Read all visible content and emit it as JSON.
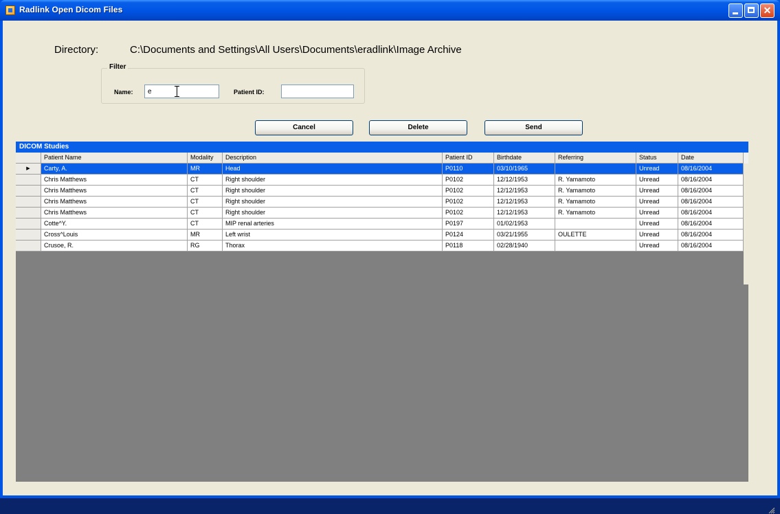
{
  "window": {
    "title": "Radlink Open Dicom Files",
    "icon": "radlink-app-icon",
    "controls": [
      "minimize-icon",
      "maximize-icon",
      "close-icon"
    ]
  },
  "directory": {
    "label": "Directory:",
    "path": "C:\\Documents and Settings\\All Users\\Documents\\eradlink\\Image Archive"
  },
  "filter": {
    "legend": "Filter",
    "name_label": "Name:",
    "name_value": "e",
    "patient_id_label": "Patient ID:",
    "patient_id_value": ""
  },
  "buttons": {
    "cancel": "Cancel",
    "delete": "Delete",
    "send": "Send"
  },
  "grid": {
    "caption": "DICOM Studies",
    "columns": [
      "Patient Name",
      "Modality",
      "Description",
      "Patient ID",
      "Birthdate",
      "Referring",
      "Status",
      "Date"
    ],
    "selected_row_indicator": "▶",
    "rows": [
      {
        "patient_name": "Carty, A.",
        "modality": "MR",
        "description": "Head",
        "patient_id": "P0110",
        "birthdate": "03/10/1965",
        "referring": "",
        "status": "Unread",
        "date": "08/16/2004",
        "selected": true
      },
      {
        "patient_name": "Chris Matthews",
        "modality": "CT",
        "description": "Right shoulder",
        "patient_id": "P0102",
        "birthdate": "12/12/1953",
        "referring": "R. Yamamoto",
        "status": "Unread",
        "date": "08/16/2004"
      },
      {
        "patient_name": "Chris Matthews",
        "modality": "CT",
        "description": "Right shoulder",
        "patient_id": "P0102",
        "birthdate": "12/12/1953",
        "referring": "R. Yamamoto",
        "status": "Unread",
        "date": "08/16/2004"
      },
      {
        "patient_name": "Chris Matthews",
        "modality": "CT",
        "description": "Right shoulder",
        "patient_id": "P0102",
        "birthdate": "12/12/1953",
        "referring": "R. Yamamoto",
        "status": "Unread",
        "date": "08/16/2004"
      },
      {
        "patient_name": "Chris Matthews",
        "modality": "CT",
        "description": "Right shoulder",
        "patient_id": "P0102",
        "birthdate": "12/12/1953",
        "referring": "R. Yamamoto",
        "status": "Unread",
        "date": "08/16/2004"
      },
      {
        "patient_name": "Cotte^Y.",
        "modality": "CT",
        "description": "MIP renal arteries",
        "patient_id": "P0197",
        "birthdate": "01/02/1953",
        "referring": "",
        "status": "Unread",
        "date": "08/16/2004"
      },
      {
        "patient_name": "Cross^Louis",
        "modality": "MR",
        "description": "Left wrist",
        "patient_id": "P0124",
        "birthdate": "03/21/1955",
        "referring": "OULETTE",
        "status": "Unread",
        "date": "08/16/2004"
      },
      {
        "patient_name": "Crusoe, R.",
        "modality": "RG",
        "description": "Thorax",
        "patient_id": "P0118",
        "birthdate": "02/28/1940",
        "referring": "",
        "status": "Unread",
        "date": "08/16/2004"
      }
    ]
  },
  "colors": {
    "title_bar": "#0055e5",
    "selection": "#0a5fe8",
    "window_bg": "#ece9d8",
    "grid_empty_bg": "#808080"
  }
}
